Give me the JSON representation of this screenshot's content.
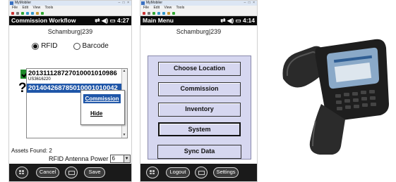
{
  "screen1": {
    "window_title": "MyMobiler",
    "menu": [
      "File",
      "Edit",
      "View",
      "Tools"
    ],
    "header_title": "Commission Workflow",
    "status_time": "4:27",
    "location": "Schamburg|239",
    "radio_rfid_label": "RFID",
    "radio_barcode_label": "Barcode",
    "radio_selected": "RFID",
    "tag_list": [
      {
        "id": "2013111287270100010109​86",
        "sub": "US3616220"
      },
      {
        "id": "201404268785010001010042",
        "sub": ""
      }
    ],
    "context_menu": {
      "commission": "Commission",
      "hide": "Hide"
    },
    "assets_found_label": "Assets Found: 2",
    "antenna_power_label": "RFID Antenna Power",
    "antenna_power_value": "6",
    "bottom_buttons": {
      "cancel": "Cancel",
      "save": "Save"
    }
  },
  "screen2": {
    "window_title": "MyMobiler",
    "menu": [
      "File",
      "Edit",
      "View",
      "Tools"
    ],
    "header_title": "Main Menu",
    "status_time": "4:14",
    "location": "Schamburg|239",
    "menu_buttons": [
      "Choose Location",
      "Commission",
      "Inventory",
      "System"
    ],
    "selected_button": "System",
    "sync_label": "Sync Data",
    "bottom_buttons": {
      "logout": "Logout",
      "settings": "Settings"
    }
  },
  "colors": {
    "selection_blue": "#1f56a8",
    "panel_lavender": "#d6d7f0",
    "header_black": "#0a0a0a"
  }
}
